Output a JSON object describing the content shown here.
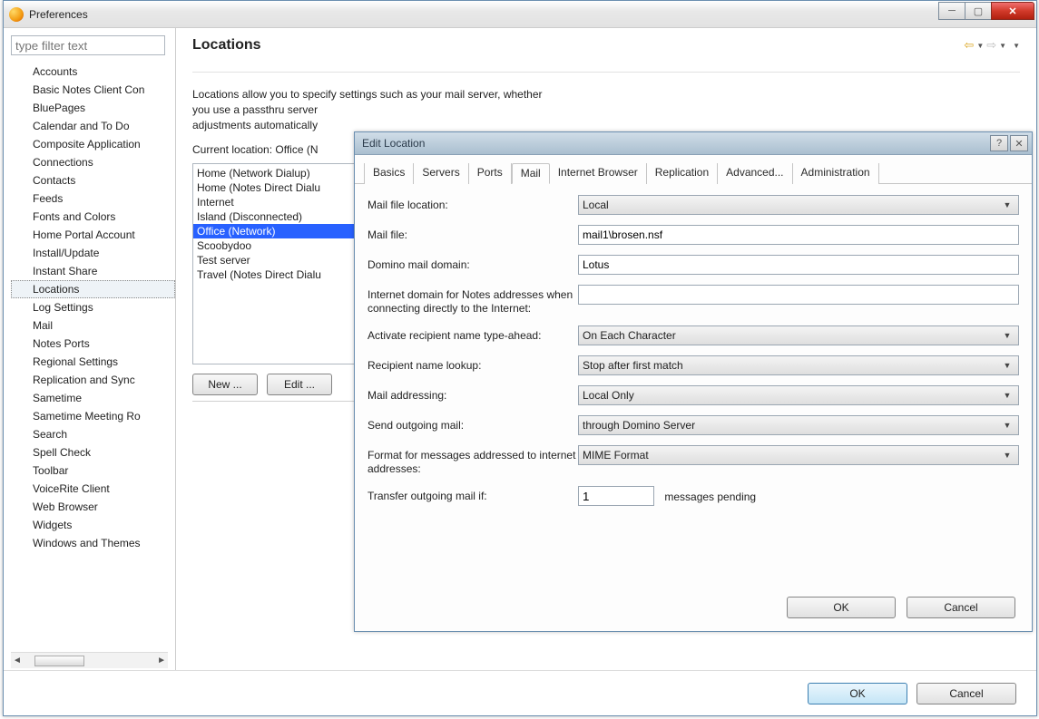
{
  "window": {
    "title": "Preferences"
  },
  "sidebar": {
    "filter_placeholder": "type filter text",
    "items": [
      "Accounts",
      "Basic Notes Client Con",
      "BluePages",
      "Calendar and To Do",
      "Composite Application",
      "Connections",
      "Contacts",
      "Feeds",
      "Fonts and Colors",
      "Home Portal Account",
      "Install/Update",
      "Instant Share",
      "Locations",
      "Log Settings",
      "Mail",
      "Notes Ports",
      "Regional Settings",
      "Replication and Sync",
      "Sametime",
      "Sametime Meeting Ro",
      "Search",
      "Spell Check",
      "Toolbar",
      "VoiceRite Client",
      "Web Browser",
      "Widgets",
      "Windows and Themes"
    ],
    "selected_index": 12
  },
  "main": {
    "heading": "Locations",
    "description_line1": "Locations allow you to specify settings such as your mail server, whether",
    "description_line2": "you use a passthru server",
    "description_line3": "adjustments automatically",
    "current_location_label": "Current location: Office (N",
    "locations": [
      "Home (Network Dialup)",
      "Home (Notes Direct Dialu",
      "Internet",
      "Island (Disconnected)",
      "Office (Network)",
      "Scoobydoo",
      "Test server",
      "Travel (Notes Direct Dialu"
    ],
    "selected_location_index": 4,
    "buttons": {
      "new": "New ...",
      "edit": "Edit ..."
    }
  },
  "bottom": {
    "ok": "OK",
    "cancel": "Cancel"
  },
  "dialog": {
    "title": "Edit Location",
    "tabs": [
      "Basics",
      "Servers",
      "Ports",
      "Mail",
      "Internet Browser",
      "Replication",
      "Advanced...",
      "Administration"
    ],
    "active_tab": 3,
    "fields": {
      "mail_file_location": {
        "label": "Mail file location:",
        "value": "Local"
      },
      "mail_file": {
        "label": "Mail file:",
        "value": "mail1\\brosen.nsf"
      },
      "domino_mail_domain": {
        "label": "Domino mail domain:",
        "value": "Lotus"
      },
      "internet_domain": {
        "label": "Internet domain for Notes addresses when connecting directly to the Internet:",
        "value": ""
      },
      "typeahead": {
        "label": "Activate recipient name type-ahead:",
        "value": "On Each Character"
      },
      "recipient_lookup": {
        "label": "Recipient name lookup:",
        "value": "Stop after first match"
      },
      "mail_addressing": {
        "label": "Mail addressing:",
        "value": "Local Only"
      },
      "send_outgoing": {
        "label": "Send outgoing mail:",
        "value": "through Domino Server"
      },
      "format_internet": {
        "label": "Format for messages addressed to internet addresses:",
        "value": "MIME Format"
      },
      "transfer_if": {
        "label": "Transfer outgoing mail if:",
        "value": "1",
        "suffix": "messages pending"
      }
    },
    "buttons": {
      "ok": "OK",
      "cancel": "Cancel"
    }
  }
}
